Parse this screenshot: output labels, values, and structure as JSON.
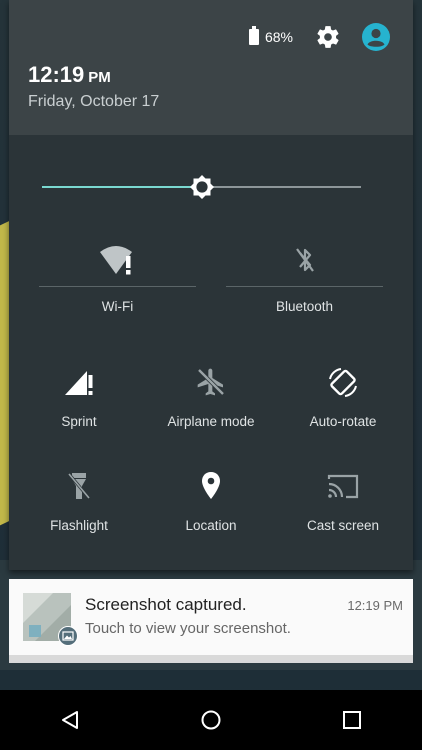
{
  "status": {
    "battery": "68%"
  },
  "header": {
    "time": "12:19",
    "ampm": "PM",
    "date": "Friday, October 17"
  },
  "brightness": {
    "level": 0.5
  },
  "tiles": {
    "wifi": "Wi-Fi",
    "bluetooth": "Bluetooth",
    "sprint": "Sprint",
    "airplane": "Airplane mode",
    "autorotate": "Auto-rotate",
    "flashlight": "Flashlight",
    "location": "Location",
    "cast": "Cast screen"
  },
  "notification": {
    "title": "Screenshot captured.",
    "time": "12:19 PM",
    "text": "Touch to view your screenshot."
  },
  "colors": {
    "accent": "#7ad8d0",
    "avatar": "#26b3cf"
  }
}
